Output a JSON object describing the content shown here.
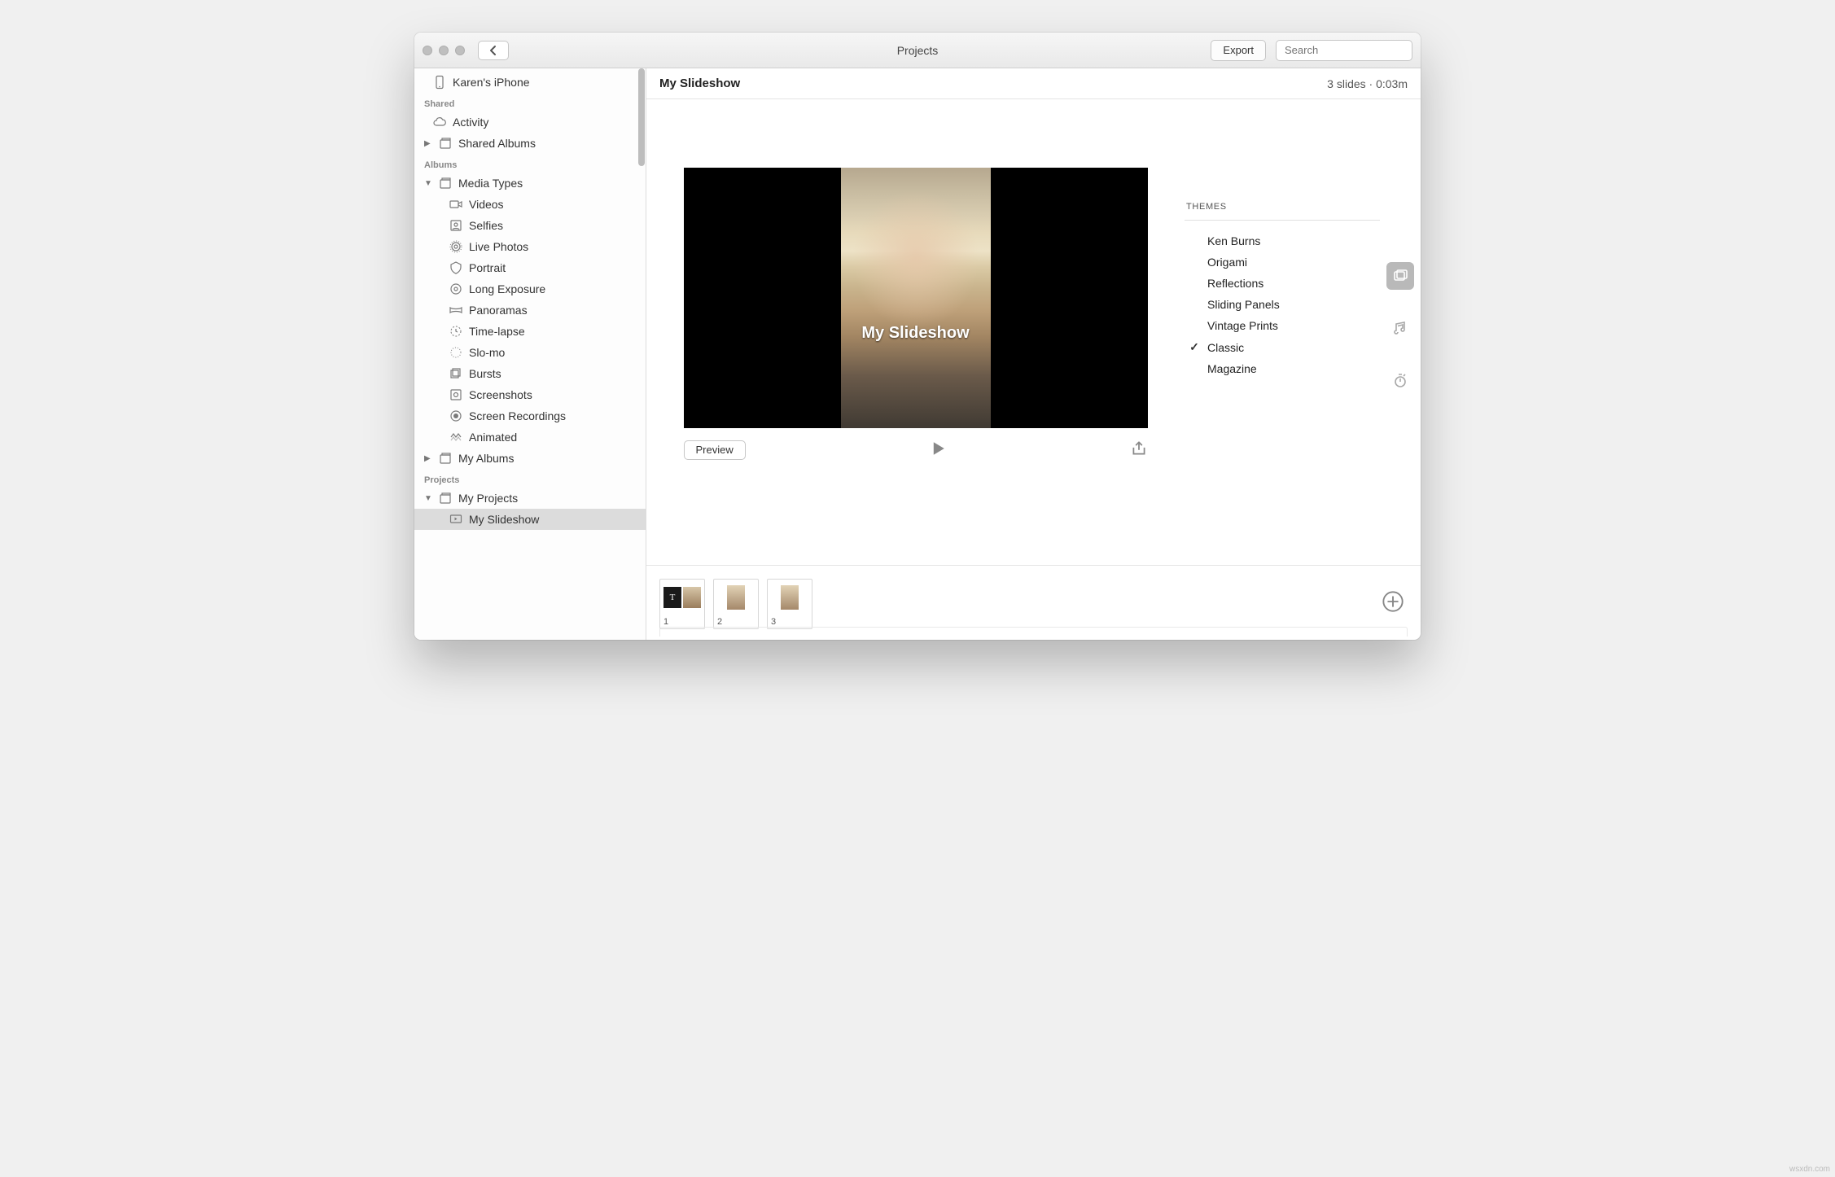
{
  "titlebar": {
    "title": "Projects",
    "export_label": "Export",
    "search_placeholder": "Search"
  },
  "sidebar": {
    "device_item": "Karen's iPhone",
    "sections": {
      "shared": "Shared",
      "albums": "Albums",
      "projects": "Projects"
    },
    "items": {
      "activity": "Activity",
      "shared_albums": "Shared Albums",
      "media_types": "Media Types",
      "videos": "Videos",
      "selfies": "Selfies",
      "live_photos": "Live Photos",
      "portrait": "Portrait",
      "long_exposure": "Long Exposure",
      "panoramas": "Panoramas",
      "time_lapse": "Time-lapse",
      "slo_mo": "Slo-mo",
      "bursts": "Bursts",
      "screenshots": "Screenshots",
      "screen_recordings": "Screen Recordings",
      "animated": "Animated",
      "my_albums": "My Albums",
      "my_projects": "My Projects",
      "my_slideshow": "My Slideshow"
    }
  },
  "main": {
    "title": "My Slideshow",
    "meta": "3 slides · 0:03m",
    "preview_overlay_title": "My Slideshow",
    "preview_label": "Preview"
  },
  "themes": {
    "header": "THEMES",
    "items": [
      {
        "label": "Ken Burns",
        "selected": false
      },
      {
        "label": "Origami",
        "selected": false
      },
      {
        "label": "Reflections",
        "selected": false
      },
      {
        "label": "Sliding Panels",
        "selected": false
      },
      {
        "label": "Vintage Prints",
        "selected": false
      },
      {
        "label": "Classic",
        "selected": true
      },
      {
        "label": "Magazine",
        "selected": false
      }
    ]
  },
  "slides": [
    {
      "n": "1"
    },
    {
      "n": "2"
    },
    {
      "n": "3"
    }
  ],
  "watermark": "wsxdn.com"
}
